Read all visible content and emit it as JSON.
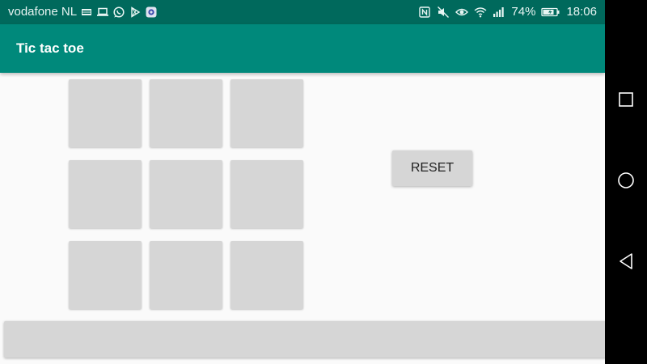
{
  "status_bar": {
    "carrier": "vodafone NL",
    "battery": "74%",
    "time": "18:06",
    "left_icons": [
      "sim-card-icon",
      "laptop-icon",
      "whatsapp-icon",
      "play-store-icon",
      "vpn-icon"
    ],
    "right_icons": [
      "nfc-icon",
      "mute-icon",
      "eye-icon",
      "wifi-icon",
      "signal-icon",
      "battery-icon"
    ]
  },
  "app_bar": {
    "title": "Tic tac toe",
    "color": "#00897b"
  },
  "board": {
    "cells": [
      "",
      "",
      "",
      "",
      "",
      "",
      "",
      "",
      ""
    ]
  },
  "reset_button": {
    "label": "RESET"
  },
  "status_message": "",
  "navigation": {
    "buttons": [
      "recents-icon",
      "home-icon",
      "back-icon"
    ]
  },
  "colors": {
    "status_bar": "#00695c",
    "app_bar": "#00897b",
    "background": "#fafafa",
    "button": "#d6d6d6",
    "nav_bar": "#000000"
  }
}
